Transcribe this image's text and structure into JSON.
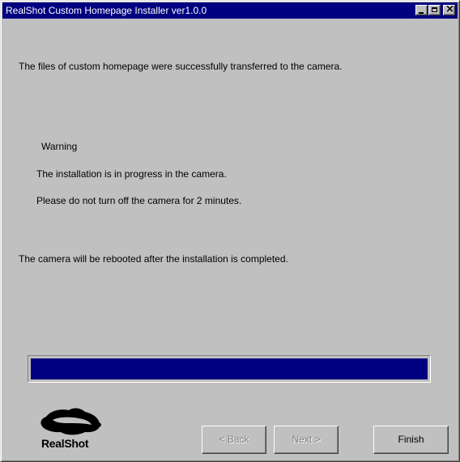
{
  "window": {
    "title": "RealShot Custom Homepage Installer ver1.0.0"
  },
  "messages": {
    "success": "The files of custom homepage were successfully transferred to the camera.",
    "warning_heading": "Warning",
    "installing": "The installation is in progress in the camera.",
    "do_not_turn_off": "Please do not turn off the camera for 2 minutes.",
    "reboot_notice": "The camera will be rebooted after the installation is completed."
  },
  "progress": {
    "fraction": 1.0,
    "color": "#000080"
  },
  "logo": {
    "text": "RealShot"
  },
  "buttons": {
    "back": "< Back",
    "next": "Next >",
    "finish": "Finish"
  }
}
